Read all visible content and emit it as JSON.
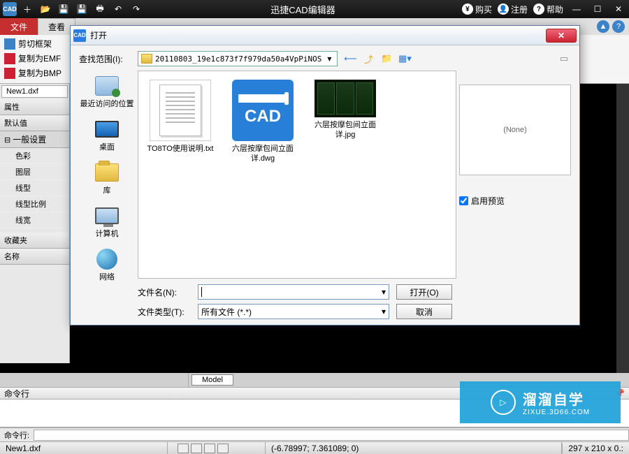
{
  "titlebar": {
    "app_title": "迅捷CAD编辑器",
    "buy": "购买",
    "register": "注册",
    "help": "帮助"
  },
  "ribbon": {
    "tabs": {
      "file": "文件",
      "view": "查看"
    },
    "items": {
      "cut_frame": "剪切框架",
      "copy_emf": "复制为EMF",
      "copy_bmp": "复制为BMP"
    }
  },
  "document_tab": "New1.dxf",
  "props": {
    "attr": "属性",
    "default": "默认值",
    "general": "一般设置",
    "rows": [
      "色彩",
      "图层",
      "线型",
      "线型比例",
      "线宽"
    ],
    "fav": "收藏夹",
    "name": "名称"
  },
  "model_tab": "Model",
  "cmd": {
    "head": "命令行",
    "label": "命令行:"
  },
  "status": {
    "file": "New1.dxf",
    "coords": "(-6.78997; 7.361089; 0)",
    "dims": "297 x 210 x 0.:"
  },
  "watermark": {
    "name": "溜溜自学",
    "url": "ZIXUE.3D66.COM"
  },
  "dialog": {
    "title": "打开",
    "range_label": "查找范围(I):",
    "path": "20110803_19e1c873f7f979da50a4VpPiNOS",
    "places": {
      "recent": "最近访问的位置",
      "desktop": "桌面",
      "library": "库",
      "computer": "计算机",
      "network": "网络"
    },
    "files": [
      {
        "name": "TO8TO使用说明.txt",
        "type": "txt"
      },
      {
        "name": "六层按摩包间立面详.dwg",
        "type": "dwg"
      },
      {
        "name": "六层按摩包间立面详.jpg",
        "type": "jpg"
      }
    ],
    "preview_none": "(None)",
    "enable_preview": "启用预览",
    "filename_label": "文件名(N):",
    "filetype_label": "文件类型(T):",
    "filetype_value": "所有文件 (*.*)",
    "open_btn": "打开(O)",
    "cancel_btn": "取消"
  }
}
